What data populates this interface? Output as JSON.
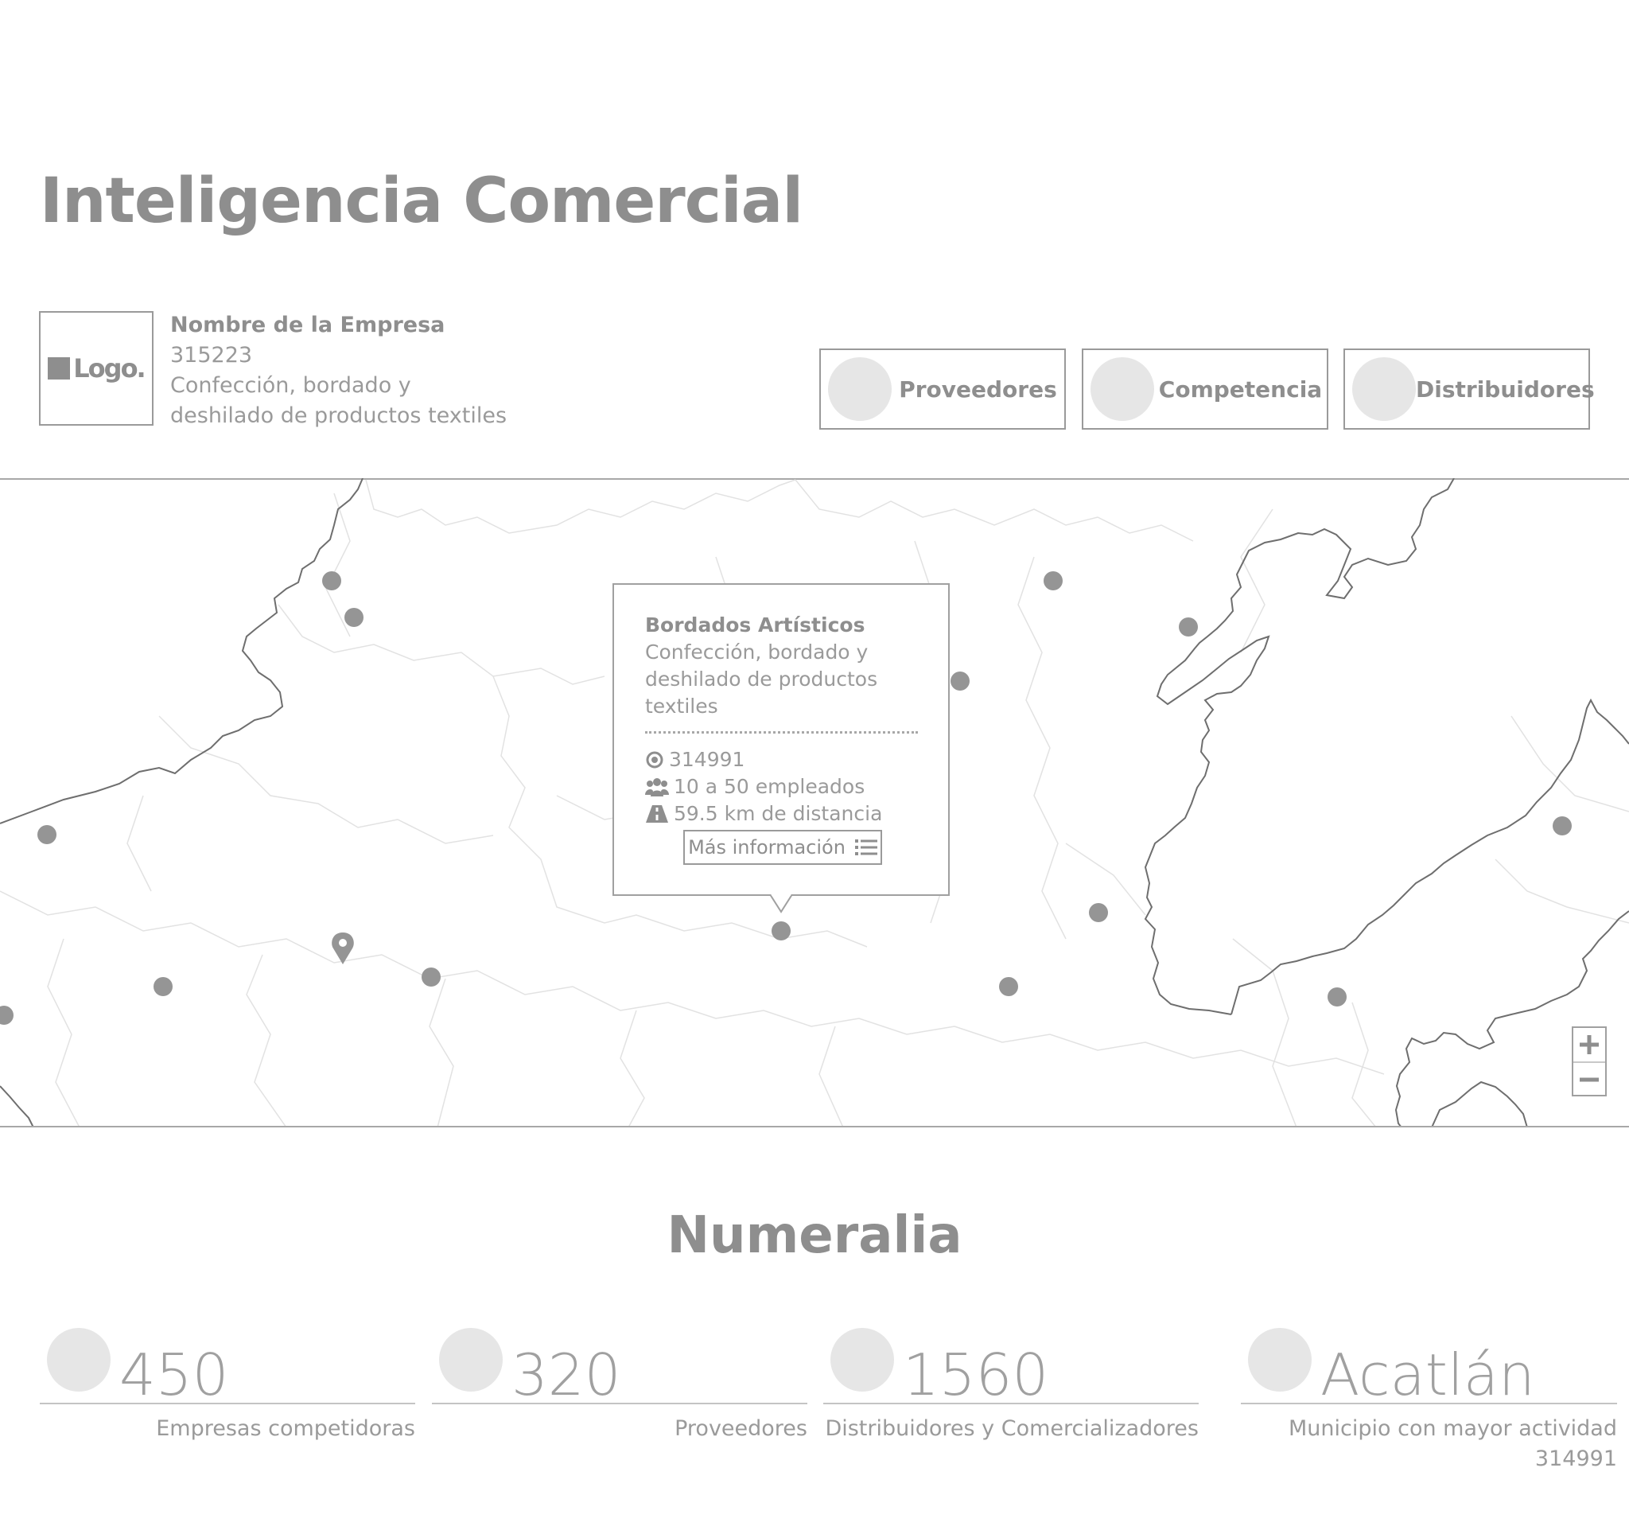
{
  "page": {
    "title": "Inteligencia Comercial"
  },
  "company": {
    "logo_text": "Logo.",
    "name": "Nombre de la Empresa",
    "code": "315223",
    "activity_line1": "Confección, bordado y",
    "activity_line2": "deshilado de productos textiles"
  },
  "categories": [
    {
      "label": "Proveedores"
    },
    {
      "label": "Competencia"
    },
    {
      "label": "Distribuidores"
    }
  ],
  "map": {
    "popup": {
      "name": "Bordados Artísticos",
      "activity_line1": "Confección, bordado y",
      "activity_line2": "deshilado de productos textiles",
      "code": "314991",
      "employees": "10 a 50 empleados",
      "distance": "59.5 km de distancia",
      "more_button": "Más información"
    },
    "zoom": {
      "in": "+",
      "out": "−"
    }
  },
  "numeralia": {
    "title": "Numeralia",
    "stats": [
      {
        "value": "450",
        "label": "Empresas competidoras"
      },
      {
        "value": "320",
        "label": "Proveedores"
      },
      {
        "value": "1560",
        "label": "Distribuidores y Comercializadores"
      },
      {
        "value": "Acatlán",
        "label": "Municipio con mayor actividad",
        "sublabel": "314991"
      }
    ]
  },
  "colors": {
    "marker": "#959595",
    "border": "#9a9a9a",
    "placeholder": "#e6e6e6"
  }
}
